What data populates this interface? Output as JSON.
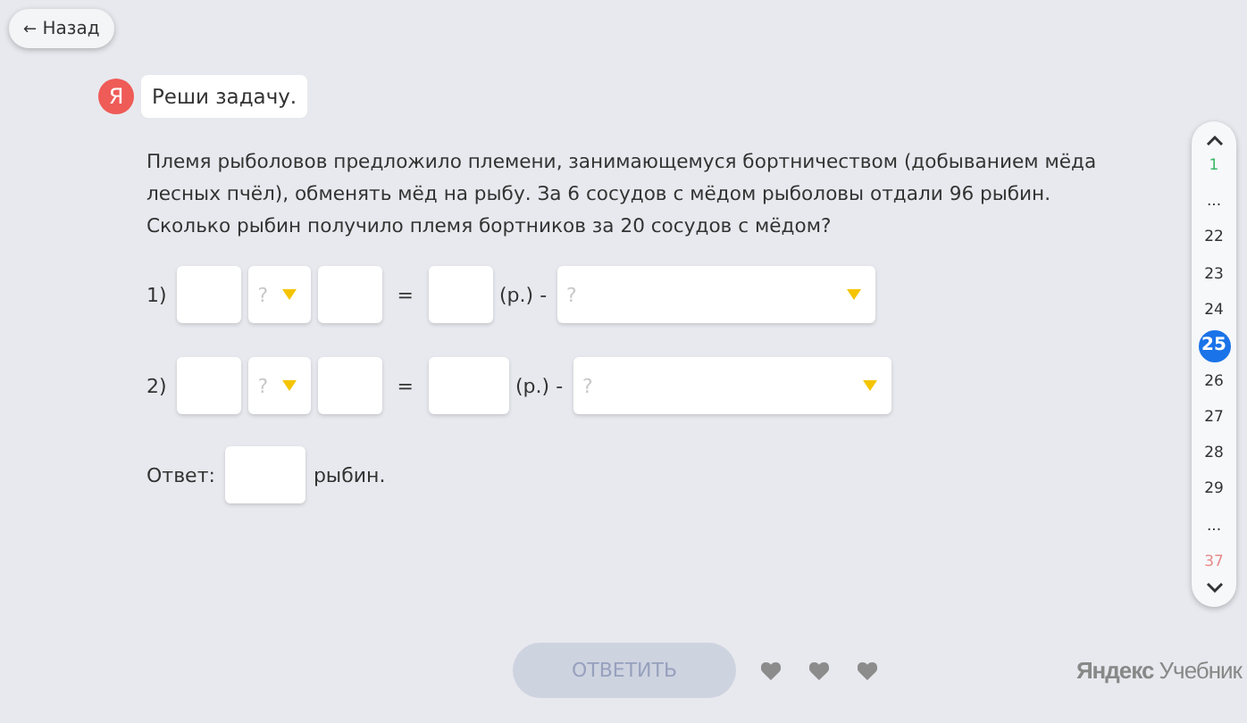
{
  "back_button": {
    "label": "Назад",
    "arrow": "←"
  },
  "assistant": {
    "logo": "Я",
    "message": "Реши задачу."
  },
  "problem": "Племя рыболовов предложило племени, занимающемуся бортничеством (добыванием мёда лесных пчёл), обменять мёд на рыбу. За 6 сосудов с мёдом рыболовы отдали 96 рыбин. Сколько рыбин получило племя бортников за 20 сосудов с мёдом?",
  "rows": [
    {
      "number": "1)",
      "operator_placeholder": "?",
      "equals": "=",
      "unit": "(р.) -",
      "meaning_placeholder": "?"
    },
    {
      "number": "2)",
      "operator_placeholder": "?",
      "equals": "=",
      "unit": "(р.) -",
      "meaning_placeholder": "?"
    }
  ],
  "answer": {
    "label": "Ответ:",
    "unit": "рыбин."
  },
  "task_nav": {
    "items": [
      {
        "label": "1",
        "selected": false,
        "color": "#3fb86a"
      },
      {
        "label": "...",
        "selected": false
      },
      {
        "label": "22",
        "selected": false
      },
      {
        "label": "23",
        "selected": false
      },
      {
        "label": "24",
        "selected": false
      },
      {
        "label": "25",
        "selected": true
      },
      {
        "label": "26",
        "selected": false
      },
      {
        "label": "27",
        "selected": false
      },
      {
        "label": "28",
        "selected": false
      },
      {
        "label": "29",
        "selected": false
      },
      {
        "label": "...",
        "selected": false
      },
      {
        "label": "37",
        "selected": false,
        "color": "#e88a8a"
      }
    ]
  },
  "submit_button": {
    "label": "ОТВЕТИТЬ",
    "disabled": true
  },
  "hearts": [
    {
      "filled": true
    },
    {
      "filled": true
    },
    {
      "filled": true
    }
  ],
  "brand": {
    "bold": "Яндекс",
    "rest": "Учебник"
  }
}
